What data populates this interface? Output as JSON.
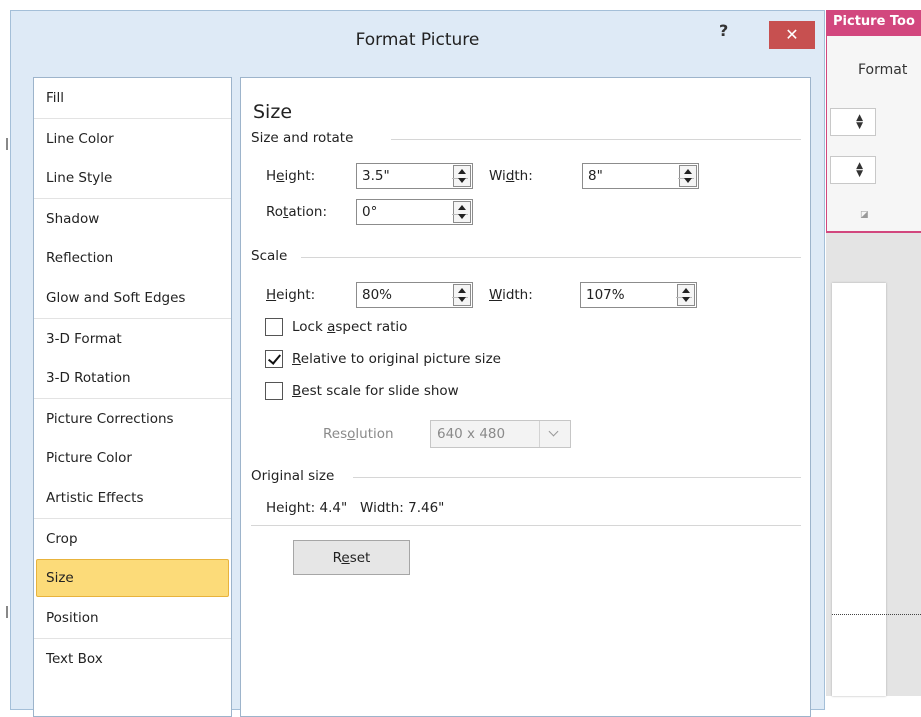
{
  "background_app": {
    "contextual_tab": "Picture Too",
    "ribbon_tab": "Format",
    "accent_color": "#d2477e"
  },
  "dialog": {
    "title": "Format Picture",
    "help_label": "?",
    "close_label": "✕",
    "close_color": "#c75050"
  },
  "nav": {
    "items": [
      {
        "label": "Fill"
      },
      {
        "label": "Line Color"
      },
      {
        "label": "Line Style"
      },
      {
        "label": "Shadow"
      },
      {
        "label": "Reflection"
      },
      {
        "label": "Glow and Soft Edges"
      },
      {
        "label": "3-D Format"
      },
      {
        "label": "3-D Rotation"
      },
      {
        "label": "Picture Corrections"
      },
      {
        "label": "Picture Color"
      },
      {
        "label": "Artistic Effects"
      },
      {
        "label": "Crop"
      },
      {
        "label": "Size"
      },
      {
        "label": "Position"
      },
      {
        "label": "Text Box"
      }
    ],
    "selected": "Size",
    "selected_color": "#fcdb79"
  },
  "content": {
    "heading": "Size",
    "size_rotate": {
      "section_label": "Size and rotate",
      "height_label": "Height:",
      "height_value": "3.5\"",
      "width_label": "Width:",
      "width_value": "8\"",
      "rotation_label": "Rotation:",
      "rotation_value": "0°"
    },
    "scale": {
      "section_label": "Scale",
      "height_label": "Height:",
      "height_value": "80%",
      "width_label": "Width:",
      "width_value": "107%",
      "lock_aspect_label": "Lock aspect ratio",
      "lock_aspect_checked": false,
      "relative_label": "Relative to original picture size",
      "relative_checked": true,
      "best_scale_label": "Best scale for slide show",
      "best_scale_checked": false,
      "resolution_label": "Resolution",
      "resolution_value": "640 x 480"
    },
    "original_size": {
      "section_label": "Original size",
      "height_label": "Height:",
      "height_value": "4.4\"",
      "width_label": "Width:",
      "width_value": "7.46\""
    },
    "reset_label": "Reset"
  }
}
